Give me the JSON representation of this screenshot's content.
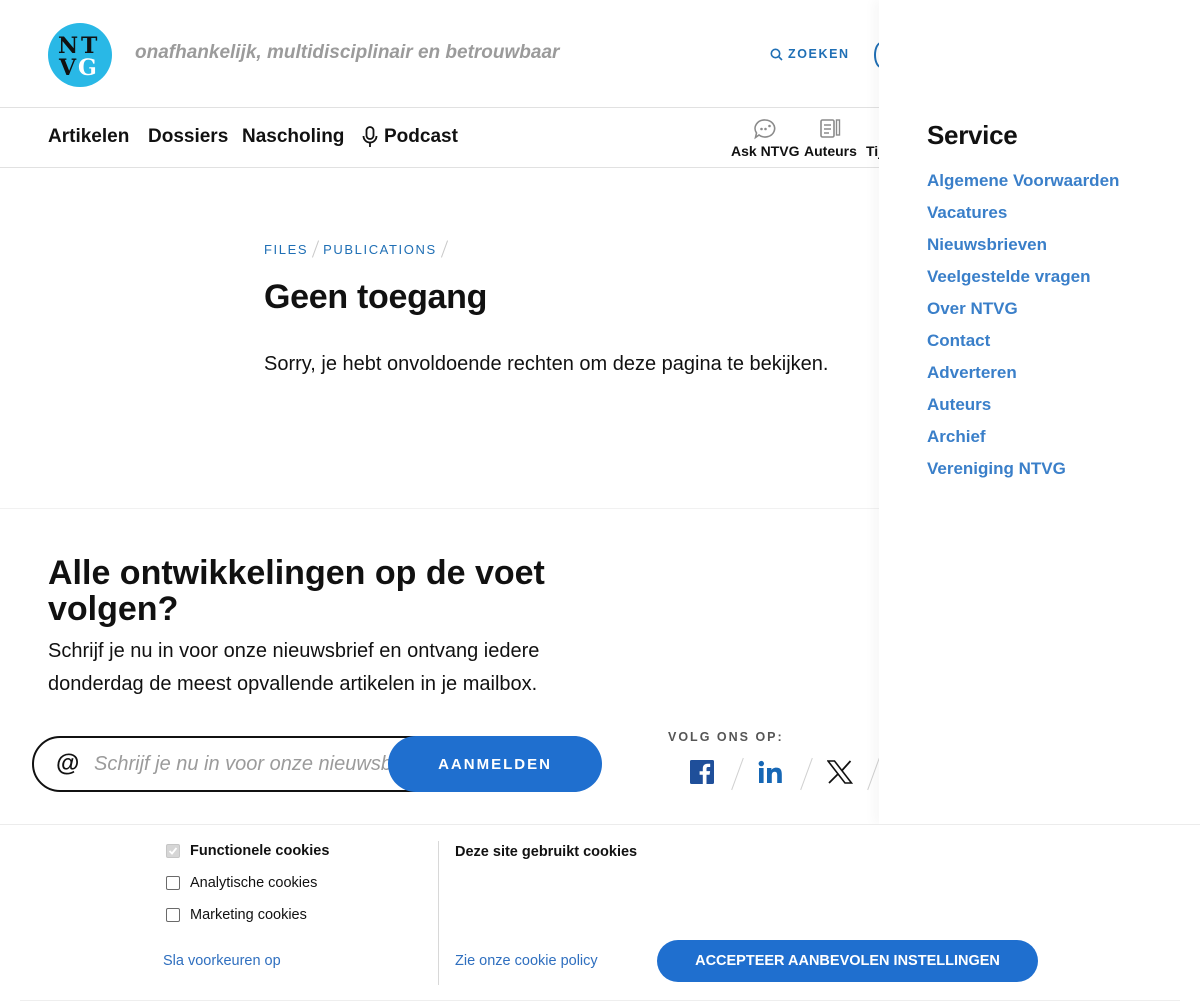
{
  "header": {
    "logo_text": "NTVG",
    "tagline": "onafhankelijk, multidisciplinair en betrouwbaar",
    "search_label": "ZOEKEN"
  },
  "nav": {
    "items": [
      {
        "label": "Artikelen"
      },
      {
        "label": "Dossiers"
      },
      {
        "label": "Nascholing"
      },
      {
        "label": "Podcast",
        "icon": "microphone-icon"
      }
    ],
    "tools": [
      {
        "label": "Ask NTVG",
        "icon": "chat-bubble-icon"
      },
      {
        "label": "Auteurs",
        "icon": "document-pen-icon"
      },
      {
        "label": "Tij"
      }
    ]
  },
  "content": {
    "breadcrumb": [
      "FILES",
      "PUBLICATIONS"
    ],
    "title": "Geen toegang",
    "message": "Sorry, je hebt onvoldoende rechten om deze pagina te bekijken."
  },
  "newsletter": {
    "title": "Alle ontwikkelingen op de voet volgen?",
    "text": "Schrijf je nu in voor onze nieuwsbrief en ontvang iedere donderdag de meest opvallende artikelen in je mailbox.",
    "input_placeholder": "Schrijf je nu in voor onze nieuwsbrief",
    "submit_label": "AANMELDEN",
    "follow_label": "VOLG ONS OP:",
    "social": [
      "facebook-icon",
      "linkedin-icon",
      "x-icon"
    ]
  },
  "service": {
    "title": "Service",
    "links": [
      "Algemene Voorwaarden",
      "Vacatures",
      "Nieuwsbrieven",
      "Veelgestelde vragen",
      "Over NTVG",
      "Contact",
      "Adverteren",
      "Auteurs",
      "Archief",
      "Vereniging NTVG"
    ]
  },
  "cookies": {
    "options": [
      {
        "label": "Functionele cookies",
        "checked": true,
        "disabled": true
      },
      {
        "label": "Analytische cookies",
        "checked": false
      },
      {
        "label": "Marketing cookies",
        "checked": false
      }
    ],
    "save_label": "Sla voorkeuren op",
    "title": "Deze site gebruikt cookies",
    "policy_label": "Zie onze cookie policy",
    "accept_label": "ACCEPTEER AANBEVOLEN INSTELLINGEN"
  },
  "colors": {
    "accent": "#1f6fcf",
    "link": "#3a7fc9",
    "logo": "#29b8e6"
  }
}
